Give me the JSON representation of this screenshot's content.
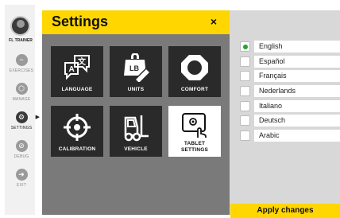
{
  "sidebar": {
    "brand": "FL TRAINER",
    "items": [
      {
        "label": "EXERCISES"
      },
      {
        "label": "MANAGE"
      },
      {
        "label": "SETTINGS"
      },
      {
        "label": "DEBUG"
      },
      {
        "label": "EXIT"
      }
    ]
  },
  "panel": {
    "title": "Settings",
    "close_label": "×",
    "tiles": [
      {
        "label": "LANGUAGE"
      },
      {
        "label": "UNITS"
      },
      {
        "label": "COMFORT"
      },
      {
        "label": "CALIBRATION"
      },
      {
        "label": "VEHICLE"
      },
      {
        "label_line1": "TABLET",
        "label_line2": "SETTINGS"
      }
    ],
    "units_badge": "LB"
  },
  "languages": {
    "selected": "English",
    "items": [
      "English",
      "Español",
      "Français",
      "Nederlands",
      "Italiano",
      "Deutsch",
      "Arabic"
    ]
  },
  "apply_label": "Apply changes",
  "colors": {
    "accent": "#ffd600",
    "selected": "#22a532"
  }
}
